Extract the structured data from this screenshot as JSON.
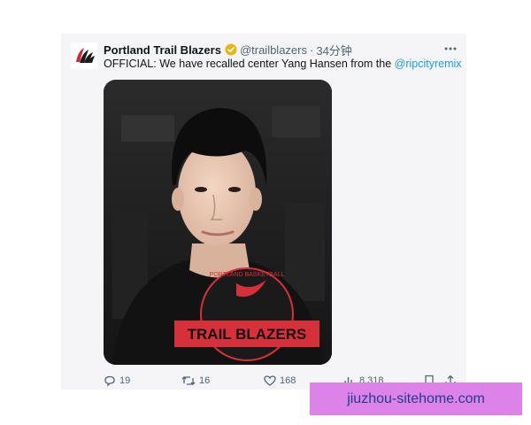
{
  "tweet": {
    "author": "Portland Trail Blazers",
    "handle": "@trailblazers",
    "separator": "·",
    "time": "34分钟",
    "text_prefix": "OFFICIAL: We have recalled center Yang Hansen from the ",
    "mention": "@ripcityremix",
    "media": {
      "shirt_arc_text": "PORTLAND BASKETBALL",
      "shirt_text": "TRAIL BLAZERS",
      "shirt_color": "#d6303a",
      "background_color": "#1a1a1a"
    }
  },
  "actions": {
    "replies": "19",
    "retweets": "16",
    "likes": "168",
    "views": "8,318"
  },
  "colors": {
    "accent": "#1d9bf0",
    "verified_badge": "#e7b416",
    "logo_red": "#cc2936"
  },
  "watermark": "jiuzhou-sitehome.com"
}
